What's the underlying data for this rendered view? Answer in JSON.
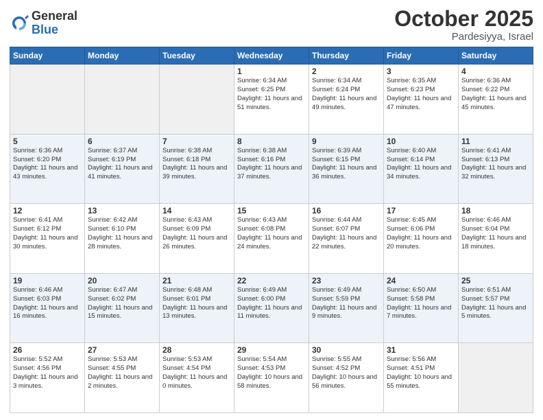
{
  "header": {
    "logo_general": "General",
    "logo_blue": "Blue",
    "month_title": "October 2025",
    "location": "Pardesiyya, Israel"
  },
  "weekdays": [
    "Sunday",
    "Monday",
    "Tuesday",
    "Wednesday",
    "Thursday",
    "Friday",
    "Saturday"
  ],
  "rows": [
    {
      "cells": [
        {
          "empty": true
        },
        {
          "empty": true
        },
        {
          "empty": true
        },
        {
          "day": "1",
          "sunrise": "6:34 AM",
          "sunset": "6:25 PM",
          "daylight": "11 hours and 51 minutes."
        },
        {
          "day": "2",
          "sunrise": "6:34 AM",
          "sunset": "6:24 PM",
          "daylight": "11 hours and 49 minutes."
        },
        {
          "day": "3",
          "sunrise": "6:35 AM",
          "sunset": "6:23 PM",
          "daylight": "11 hours and 47 minutes."
        },
        {
          "day": "4",
          "sunrise": "6:36 AM",
          "sunset": "6:22 PM",
          "daylight": "11 hours and 45 minutes."
        }
      ]
    },
    {
      "cells": [
        {
          "day": "5",
          "sunrise": "6:36 AM",
          "sunset": "6:20 PM",
          "daylight": "11 hours and 43 minutes."
        },
        {
          "day": "6",
          "sunrise": "6:37 AM",
          "sunset": "6:19 PM",
          "daylight": "11 hours and 41 minutes."
        },
        {
          "day": "7",
          "sunrise": "6:38 AM",
          "sunset": "6:18 PM",
          "daylight": "11 hours and 39 minutes."
        },
        {
          "day": "8",
          "sunrise": "6:38 AM",
          "sunset": "6:16 PM",
          "daylight": "11 hours and 37 minutes."
        },
        {
          "day": "9",
          "sunrise": "6:39 AM",
          "sunset": "6:15 PM",
          "daylight": "11 hours and 36 minutes."
        },
        {
          "day": "10",
          "sunrise": "6:40 AM",
          "sunset": "6:14 PM",
          "daylight": "11 hours and 34 minutes."
        },
        {
          "day": "11",
          "sunrise": "6:41 AM",
          "sunset": "6:13 PM",
          "daylight": "11 hours and 32 minutes."
        }
      ]
    },
    {
      "cells": [
        {
          "day": "12",
          "sunrise": "6:41 AM",
          "sunset": "6:12 PM",
          "daylight": "11 hours and 30 minutes."
        },
        {
          "day": "13",
          "sunrise": "6:42 AM",
          "sunset": "6:10 PM",
          "daylight": "11 hours and 28 minutes."
        },
        {
          "day": "14",
          "sunrise": "6:43 AM",
          "sunset": "6:09 PM",
          "daylight": "11 hours and 26 minutes."
        },
        {
          "day": "15",
          "sunrise": "6:43 AM",
          "sunset": "6:08 PM",
          "daylight": "11 hours and 24 minutes."
        },
        {
          "day": "16",
          "sunrise": "6:44 AM",
          "sunset": "6:07 PM",
          "daylight": "11 hours and 22 minutes."
        },
        {
          "day": "17",
          "sunrise": "6:45 AM",
          "sunset": "6:06 PM",
          "daylight": "11 hours and 20 minutes."
        },
        {
          "day": "18",
          "sunrise": "6:46 AM",
          "sunset": "6:04 PM",
          "daylight": "11 hours and 18 minutes."
        }
      ]
    },
    {
      "cells": [
        {
          "day": "19",
          "sunrise": "6:46 AM",
          "sunset": "6:03 PM",
          "daylight": "11 hours and 16 minutes."
        },
        {
          "day": "20",
          "sunrise": "6:47 AM",
          "sunset": "6:02 PM",
          "daylight": "11 hours and 15 minutes."
        },
        {
          "day": "21",
          "sunrise": "6:48 AM",
          "sunset": "6:01 PM",
          "daylight": "11 hours and 13 minutes."
        },
        {
          "day": "22",
          "sunrise": "6:49 AM",
          "sunset": "6:00 PM",
          "daylight": "11 hours and 11 minutes."
        },
        {
          "day": "23",
          "sunrise": "6:49 AM",
          "sunset": "5:59 PM",
          "daylight": "11 hours and 9 minutes."
        },
        {
          "day": "24",
          "sunrise": "6:50 AM",
          "sunset": "5:58 PM",
          "daylight": "11 hours and 7 minutes."
        },
        {
          "day": "25",
          "sunrise": "6:51 AM",
          "sunset": "5:57 PM",
          "daylight": "11 hours and 5 minutes."
        }
      ]
    },
    {
      "cells": [
        {
          "day": "26",
          "sunrise": "5:52 AM",
          "sunset": "4:56 PM",
          "daylight": "11 hours and 3 minutes."
        },
        {
          "day": "27",
          "sunrise": "5:53 AM",
          "sunset": "4:55 PM",
          "daylight": "11 hours and 2 minutes."
        },
        {
          "day": "28",
          "sunrise": "5:53 AM",
          "sunset": "4:54 PM",
          "daylight": "11 hours and 0 minutes."
        },
        {
          "day": "29",
          "sunrise": "5:54 AM",
          "sunset": "4:53 PM",
          "daylight": "10 hours and 58 minutes."
        },
        {
          "day": "30",
          "sunrise": "5:55 AM",
          "sunset": "4:52 PM",
          "daylight": "10 hours and 56 minutes."
        },
        {
          "day": "31",
          "sunrise": "5:56 AM",
          "sunset": "4:51 PM",
          "daylight": "10 hours and 55 minutes."
        },
        {
          "empty": true
        }
      ]
    }
  ]
}
